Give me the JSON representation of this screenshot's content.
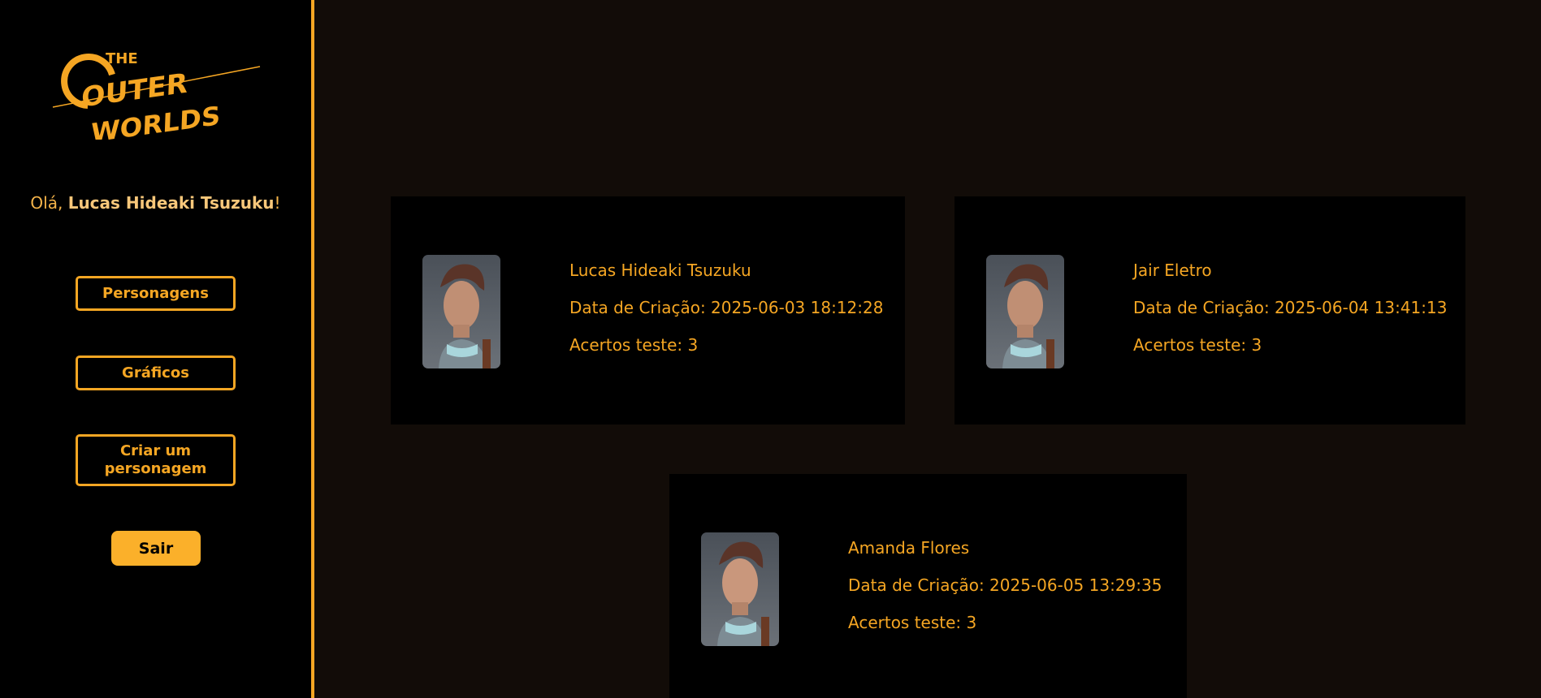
{
  "sidebar": {
    "logo": {
      "line1": "THE",
      "line2": "OUTER",
      "line3": "WORLDS"
    },
    "greeting": {
      "prefix": "Olá, ",
      "name": "Lucas Hideaki Tsuzuku",
      "suffix": "!"
    },
    "nav": {
      "characters_label": "Personagens",
      "charts_label": "Gráficos",
      "create_label": "Criar um personagem",
      "logout_label": "Sair"
    }
  },
  "colors": {
    "accent": "#f5a623",
    "background": "#120c08",
    "panel": "#000000"
  },
  "characters": [
    {
      "name": "Lucas Hideaki Tsuzuku",
      "created": "Data de Criação: 2025-06-03 18:12:28",
      "score": "Acertos teste: 3"
    },
    {
      "name": "Jair Eletro",
      "created": "Data de Criação: 2025-06-04 13:41:13",
      "score": "Acertos teste: 3"
    },
    {
      "name": "Amanda Flores",
      "created": "Data de Criação: 2025-06-05 13:29:35",
      "score": "Acertos teste: 3"
    }
  ]
}
